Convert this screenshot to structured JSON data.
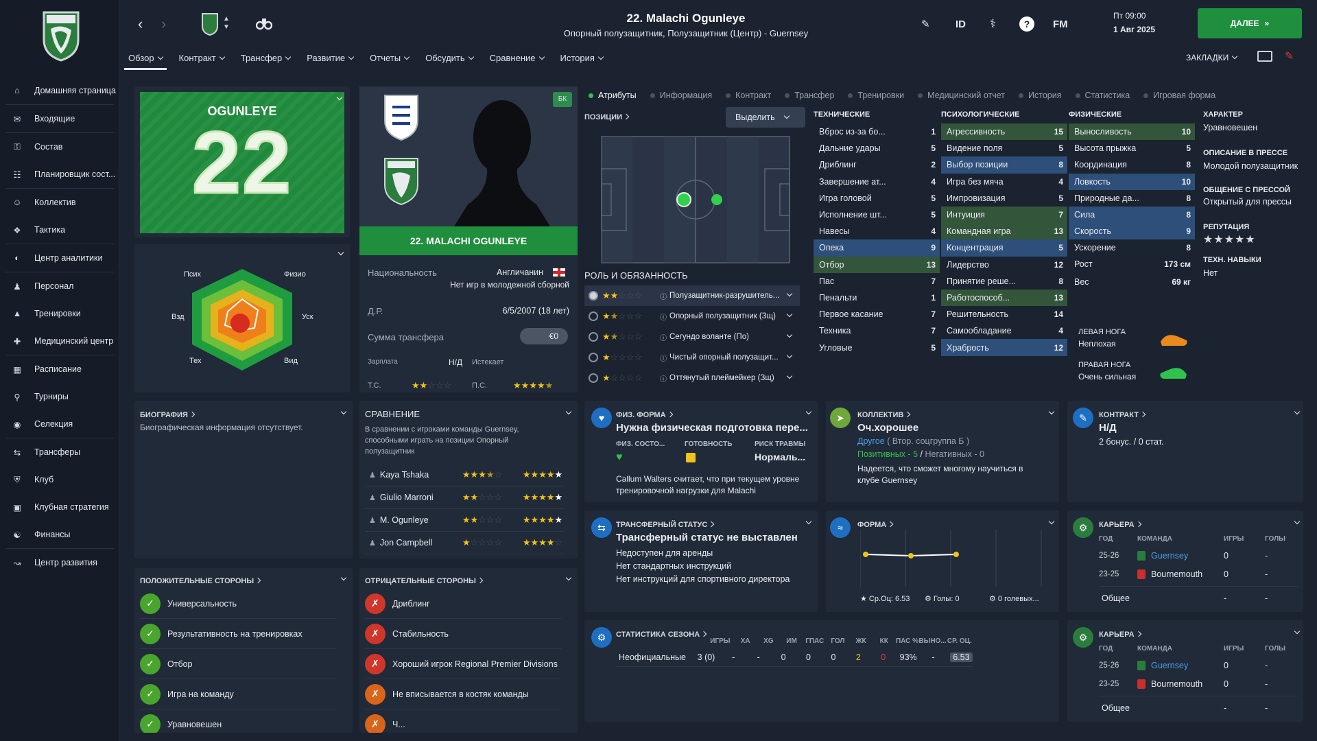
{
  "sidebar": {
    "items": [
      {
        "label": "Домашняя страница",
        "icon": "home-icon"
      },
      {
        "label": "Входящие",
        "icon": "mail-icon"
      },
      {
        "label": "Состав",
        "icon": "shirt-icon"
      },
      {
        "label": "Планировщик сост...",
        "icon": "planner-icon"
      },
      {
        "label": "Коллектив",
        "icon": "collective-icon"
      },
      {
        "label": "Тактика",
        "icon": "tactics-icon"
      },
      {
        "label": "Центр аналитики",
        "icon": "analytics-icon"
      },
      {
        "label": "Персонал",
        "icon": "staff-icon"
      },
      {
        "label": "Тренировки",
        "icon": "training-icon"
      },
      {
        "label": "Медицинский центр",
        "icon": "medical-icon"
      },
      {
        "label": "Расписание",
        "icon": "calendar-icon"
      },
      {
        "label": "Турниры",
        "icon": "trophy-icon"
      },
      {
        "label": "Селекция",
        "icon": "binoculars-icon"
      },
      {
        "label": "Трансферы",
        "icon": "transfers-icon"
      },
      {
        "label": "Клуб",
        "icon": "club-icon"
      },
      {
        "label": "Клубная стратегия",
        "icon": "strategy-icon"
      },
      {
        "label": "Финансы",
        "icon": "finance-icon"
      },
      {
        "label": "Центр развития",
        "icon": "development-icon"
      }
    ]
  },
  "header": {
    "title": "22. Malachi Ogunleye",
    "subtitle": "Опорный полузащитник, Полузащитник (Центр) - Guernsey",
    "day_time": "Пт 09:00",
    "date": "1 Авг 2025",
    "next_label": "ДАЛЕЕ",
    "id_label": "ID",
    "fm_label": "FM",
    "bookmarks_label": "ЗАКЛАДКИ"
  },
  "tabs": [
    "Обзор",
    "Контракт",
    "Трансфер",
    "Развитие",
    "Отчеты",
    "Обсудить",
    "Сравнение",
    "История"
  ],
  "card": {
    "surname": "OGUNLEYE",
    "number": "22",
    "name_banner": "22. MALACHI OGUNLEYE",
    "badge": "БК"
  },
  "radar": {
    "labels": [
      "Псих",
      "Физио",
      "Уск",
      "Вид",
      "Тех",
      "Взд"
    ]
  },
  "info": {
    "nationality_label": "Национальность",
    "nationality": "Англичанин",
    "youth_note": "Нет игр в молодежной сборной",
    "dob_label": "Д.Р.",
    "dob": "6/5/2007 (18 лет)",
    "transfer_label": "Сумма трансфера",
    "transfer_value": "€0",
    "wage_label": "Зарплата",
    "wage_value": "Н/Д",
    "expires_label": "Истекает",
    "ca_label": "Т.С.",
    "pa_label": "П.С.",
    "ca_stars": 2,
    "pa_stars": 4.5
  },
  "subtabs": [
    "Атрибуты",
    "Информация",
    "Контракт",
    "Трансфер",
    "Тренировки",
    "Медицинский отчет",
    "История",
    "Статистика",
    "Игровая форма"
  ],
  "positions": {
    "title": "ПОЗИЦИИ",
    "select_label": "Выделить"
  },
  "roles": {
    "title": "РОЛЬ И ОБЯЗАННОСТЬ",
    "items": [
      {
        "label": "Полузащитник-разрушитель...",
        "stars": 2
      },
      {
        "label": "Опорный полузащитник (Зщ)",
        "stars": 1.5
      },
      {
        "label": "Сегундо воланте (По)",
        "stars": 1.5
      },
      {
        "label": "Чистый опорный полузащит...",
        "stars": 1
      },
      {
        "label": "Оттянутый плеймейкер (Зщ)",
        "stars": 1
      }
    ]
  },
  "technical": {
    "title": "ТЕХНИЧЕСКИЕ",
    "rows": [
      {
        "name": "Вброс из-за бо...",
        "value": "1",
        "hl": ""
      },
      {
        "name": "Дальние удары",
        "value": "5",
        "hl": ""
      },
      {
        "name": "Дриблинг",
        "value": "2",
        "hl": ""
      },
      {
        "name": "Завершение ат...",
        "value": "4",
        "hl": ""
      },
      {
        "name": "Игра головой",
        "value": "5",
        "hl": ""
      },
      {
        "name": "Исполнение шт...",
        "value": "5",
        "hl": ""
      },
      {
        "name": "Навесы",
        "value": "4",
        "hl": ""
      },
      {
        "name": "Опека",
        "value": "9",
        "hl": "hl"
      },
      {
        "name": "Отбор",
        "value": "13",
        "hl": "hlg"
      },
      {
        "name": "Пас",
        "value": "7",
        "hl": ""
      },
      {
        "name": "Пенальти",
        "value": "1",
        "hl": ""
      },
      {
        "name": "Первое касание",
        "value": "7",
        "hl": ""
      },
      {
        "name": "Техника",
        "value": "7",
        "hl": ""
      },
      {
        "name": "Угловые",
        "value": "5",
        "hl": ""
      }
    ]
  },
  "mental": {
    "title": "ПСИХОЛОГИЧЕСКИЕ",
    "rows": [
      {
        "name": "Агрессивность",
        "value": "15",
        "hl": "hlg"
      },
      {
        "name": "Видение поля",
        "value": "5",
        "hl": ""
      },
      {
        "name": "Выбор позиции",
        "value": "8",
        "hl": "hl"
      },
      {
        "name": "Игра без мяча",
        "value": "4",
        "hl": ""
      },
      {
        "name": "Импровизация",
        "value": "5",
        "hl": ""
      },
      {
        "name": "Интуиция",
        "value": "7",
        "hl": "hlg"
      },
      {
        "name": "Командная игра",
        "value": "13",
        "hl": "hlg"
      },
      {
        "name": "Концентрация",
        "value": "5",
        "hl": "hl"
      },
      {
        "name": "Лидерство",
        "value": "12",
        "hl": ""
      },
      {
        "name": "Принятие реше...",
        "value": "8",
        "hl": ""
      },
      {
        "name": "Работоспособ...",
        "value": "13",
        "hl": "hlg"
      },
      {
        "name": "Решительность",
        "value": "14",
        "hl": ""
      },
      {
        "name": "Самообладание",
        "value": "4",
        "hl": ""
      },
      {
        "name": "Храбрость",
        "value": "12",
        "hl": "hl"
      }
    ]
  },
  "physical": {
    "title": "ФИЗИЧЕСКИЕ",
    "rows": [
      {
        "name": "Выносливость",
        "value": "10",
        "hl": "hlg"
      },
      {
        "name": "Высота прыжка",
        "value": "5",
        "hl": ""
      },
      {
        "name": "Координация",
        "value": "8",
        "hl": ""
      },
      {
        "name": "Ловкость",
        "value": "10",
        "hl": "hl"
      },
      {
        "name": "Природные да...",
        "value": "8",
        "hl": ""
      },
      {
        "name": "Сила",
        "value": "8",
        "hl": "hl"
      },
      {
        "name": "Скорость",
        "value": "9",
        "hl": "hl"
      },
      {
        "name": "Ускорение",
        "value": "8",
        "hl": ""
      }
    ],
    "height_label": "Рост",
    "height": "173 см",
    "weight_label": "Вес",
    "weight": "69 кг",
    "left_foot_label": "ЛЕВАЯ НОГА",
    "left_foot": "Неплохая",
    "right_foot_label": "ПРАВАЯ НОГА",
    "right_foot": "Очень сильная"
  },
  "character": {
    "title": "ХАРАКТЕР",
    "value": "Уравновешен",
    "press_desc_title": "ОПИСАНИЕ В ПРЕССЕ",
    "press_desc": "Молодой полузащитник",
    "press_comm_title": "ОБЩЕНИЕ С ПРЕССОЙ",
    "press_comm": "Открытый для прессы",
    "rep_title": "РЕПУТАЦИЯ",
    "rep_stars": 5,
    "skills_title": "ТЕХН. НАВЫКИ",
    "skills": "Нет"
  },
  "bio": {
    "title": "БИОГРАФИЯ",
    "text": "Биографическая информация отсутствует."
  },
  "compare": {
    "title": "СРАВНЕНИЕ",
    "text": "В сравнении с игроками команды Guernsey, способными играть на позиции Опорный полузащитник",
    "rows": [
      {
        "name": "Kaya Tshaka",
        "ca": 3.5,
        "pa": 5
      },
      {
        "name": "Giulio Marroni",
        "ca": 2,
        "pa": 5
      },
      {
        "name": "M. Ogunleye",
        "ca": 2,
        "pa": 5
      },
      {
        "name": "Jon Campbell",
        "ca": 1,
        "pa": 4
      }
    ]
  },
  "strengths": {
    "title": "ПОЛОЖИТЕЛЬНЫЕ СТОРОНЫ",
    "items": [
      "Универсальность",
      "Результативность на тренировках",
      "Отбор",
      "Игра на команду",
      "Уравновешен"
    ]
  },
  "weaknesses": {
    "title": "ОТРИЦАТЕЛЬНЫЕ СТОРОНЫ",
    "items": [
      "Дриблинг",
      "Стабильность",
      "Хороший игрок Regional Premier Divisions",
      "Не вписывается в костяк команды",
      "Ч..."
    ]
  },
  "fitness": {
    "title": "ФИЗ. ФОРМА",
    "headline": "Нужна физическая подготовка пере...",
    "col1": "ФИЗ. СОСТО...",
    "col2": "ГОТОВНОСТЬ",
    "col3": "РИСК ТРАВМЫ",
    "col3_val": "Нормаль...",
    "note": "Callum Walters считает, что при текущем уровне тренировочной нагрузки для Malachi"
  },
  "collective": {
    "title": "КОЛЛЕКТИВ",
    "headline": "Оч.хорошее",
    "group": "Другое",
    "group_rest": "( Втор. соцгруппа Б )",
    "pos": "Позитивных - 5",
    "neg": "Негативных - 0",
    "note": "Надеется, что сможет многому научиться в клубе Guernsey"
  },
  "contract": {
    "title": "КОНТРАКТ",
    "headline": "Н/Д",
    "sub": "2 бонус. / 0 стат."
  },
  "transfer_status": {
    "title": "ТРАНСФЕРНЫЙ СТАТУС",
    "headline": "Трансферный статус не выставлен",
    "lines": [
      "Недоступен для аренды",
      "Нет стандартных инструкций",
      "Нет инструкций для спортивного директора"
    ]
  },
  "form": {
    "title": "ФОРМА",
    "avg": "Ср.Оц: 6.53",
    "goals": "Голы: 0",
    "assists": "0 голевых..."
  },
  "career1": {
    "title": "КАРЬЕРА",
    "h_year": "ГОД",
    "h_team": "КОМАНДА",
    "h_apps": "ИГРЫ",
    "h_goals": "ГОЛЫ",
    "rows": [
      {
        "year": "25-26",
        "team": "Guernsey",
        "apps": "0",
        "goals": "-"
      },
      {
        "year": "23-25",
        "team": "Bournemouth",
        "apps": "0",
        "goals": "-"
      }
    ],
    "total": "Общее",
    "total_apps": "-",
    "total_goals": "-"
  },
  "career2": {
    "title": "КАРЬЕРА",
    "h_year": "ГОД",
    "h_team": "КОМАНДА",
    "h_apps": "ИГРЫ",
    "h_goals": "ГОЛЫ",
    "rows": [
      {
        "year": "25-26",
        "team": "Guernsey",
        "apps": "0",
        "goals": "-"
      },
      {
        "year": "23-25",
        "team": "Bournemouth",
        "apps": "0",
        "goals": "-"
      }
    ],
    "total": "Общее",
    "total_apps": "-",
    "total_goals": "-"
  },
  "season": {
    "title": "СТАТИСТИКА СЕЗОНА",
    "headers": [
      "ИГРЫ",
      "ХА",
      "XG",
      "ИМ",
      "ГПАС",
      "ГОЛ",
      "ЖК",
      "КК",
      "ПАС %",
      "ВЫНО...",
      "СР. ОЦ."
    ],
    "row_label": "Неофициальные",
    "values": [
      "3 (0)",
      "-",
      "-",
      "0",
      "0",
      "0",
      "2",
      "0",
      "93%",
      "-",
      "6.53"
    ]
  },
  "colors": {
    "accent_green": "#1f8f3d",
    "highlight_blue": "#2d4f7a",
    "star": "#f1c21b"
  }
}
